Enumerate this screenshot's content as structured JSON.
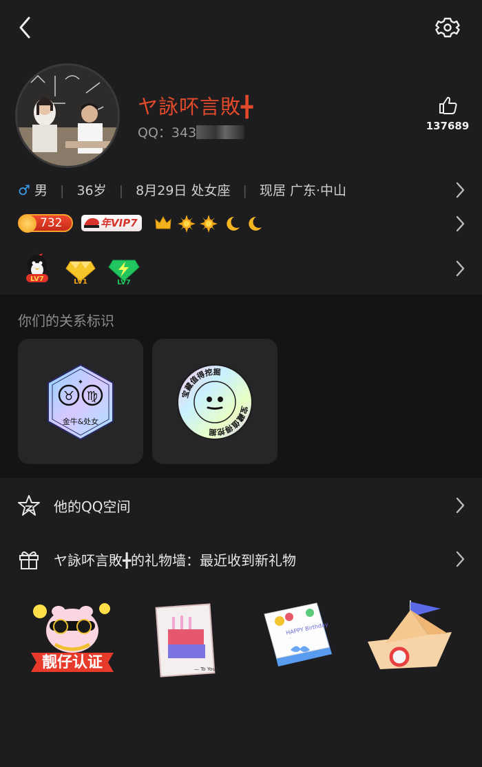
{
  "profile": {
    "nickname": "ヤ詠吥言敗╋",
    "qq_label": "QQ：343",
    "likes": "137689"
  },
  "info": {
    "gender_symbol": "♂",
    "gender": "男",
    "age": "36岁",
    "birthday": "8月29日 处女座",
    "location": "现居 广东·中山"
  },
  "badges": {
    "level": "732",
    "vip": "年VIP7",
    "lv_labels": [
      "LV7",
      "LV1",
      "LV7"
    ]
  },
  "relationship": {
    "title": "你们的关系标识",
    "zodiac_label": "金牛&处女",
    "treasure_label": "宝藏值得挖掘"
  },
  "links": {
    "qzone": "他的QQ空间",
    "gift_wall": "ヤ詠吥言敗╋的礼物墙：最近收到新礼物"
  },
  "gifts": {
    "pig_banner": "靓仔认证",
    "card_text": "— To You!",
    "book_text": "HAPPY Birthday"
  },
  "colors": {
    "background": "#1d1d1f",
    "section": "#141414",
    "card": "#262628",
    "nickname": "#e04a2a",
    "gender": "#3aa0f0"
  }
}
